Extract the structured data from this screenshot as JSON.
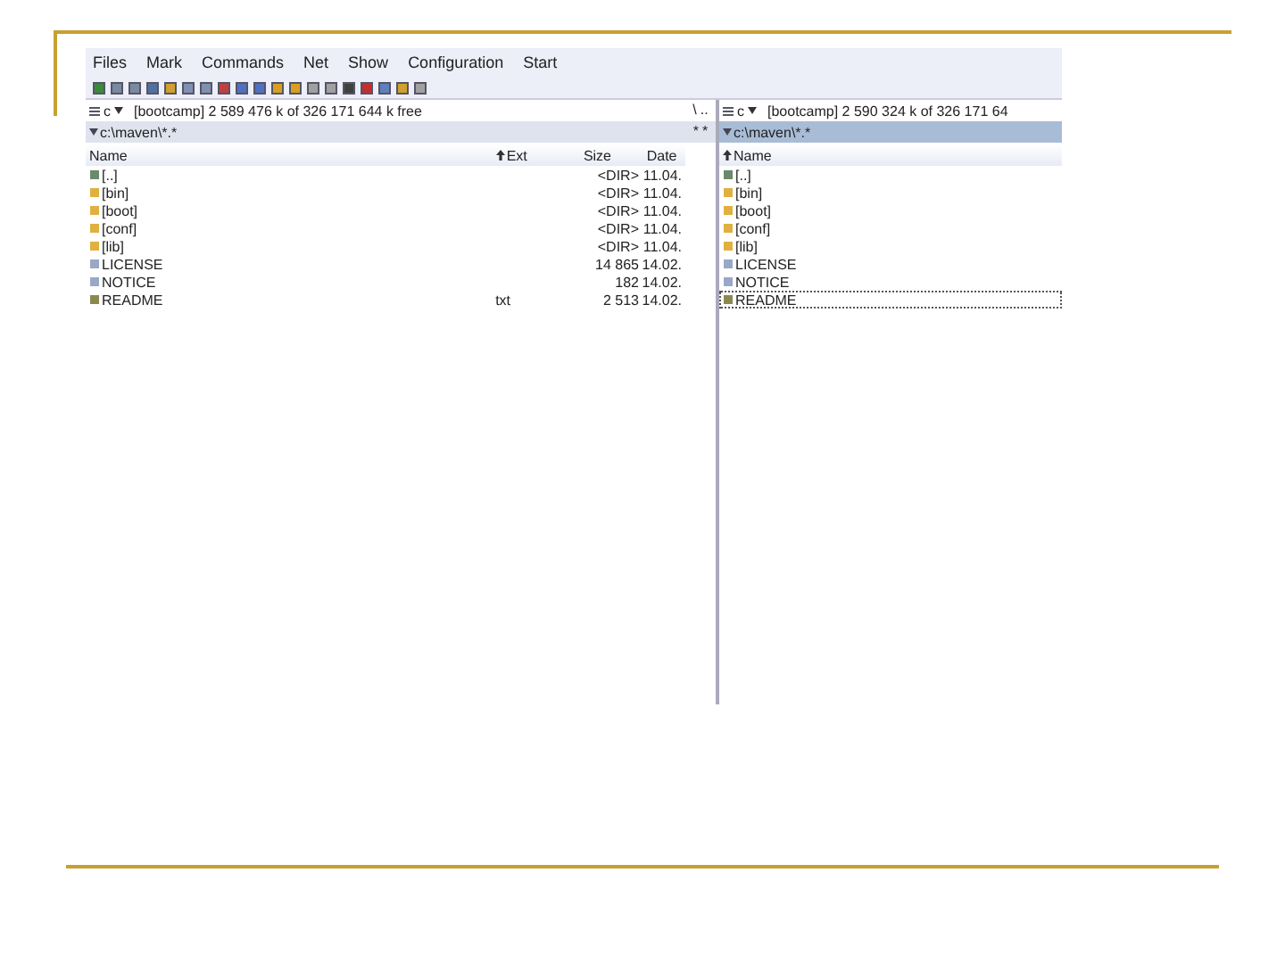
{
  "menu": [
    "Files",
    "Mark",
    "Commands",
    "Net",
    "Show",
    "Configuration",
    "Start"
  ],
  "left_panel": {
    "drive": "c",
    "drive_info": "[bootcamp]  2 589 476 k of 326 171 644 k free",
    "path": "c:\\maven\\*.*",
    "columns": [
      {
        "label": "Name",
        "sorted": false
      },
      {
        "label": "Ext",
        "sorted": true
      },
      {
        "label": "Size",
        "sorted": false
      },
      {
        "label": "Date",
        "sorted": false
      }
    ],
    "rows": [
      {
        "kind": "up",
        "name": "[..]",
        "size": "<DIR>",
        "date": "11.04."
      },
      {
        "kind": "folder",
        "name": "[bin]",
        "size": "<DIR>",
        "date": "11.04."
      },
      {
        "kind": "folder",
        "name": "[boot]",
        "size": "<DIR>",
        "date": "11.04."
      },
      {
        "kind": "folder",
        "name": "[conf]",
        "size": "<DIR>",
        "date": "11.04."
      },
      {
        "kind": "folder",
        "name": "[lib]",
        "size": "<DIR>",
        "date": "11.04."
      },
      {
        "kind": "file",
        "name": "LICENSE",
        "size": "14 865",
        "date": "14.02."
      },
      {
        "kind": "file",
        "name": "NOTICE",
        "size": "182",
        "date": "14.02."
      },
      {
        "kind": "text",
        "name": "README",
        "ext": "txt",
        "size": "2 513",
        "date": "14.02."
      }
    ]
  },
  "middle_buttons": [
    "\\",
    "..",
    "*",
    "*"
  ],
  "right_panel": {
    "drive": "c",
    "drive_info": "[bootcamp]  2 590 324 k of 326 171 64",
    "path": "c:\\maven\\*.*",
    "columns": [
      {
        "label": "Name",
        "sorted": true
      }
    ],
    "rows": [
      {
        "kind": "up",
        "name": "[..]",
        "cursor": false
      },
      {
        "kind": "folder",
        "name": "[bin]",
        "cursor": false
      },
      {
        "kind": "folder",
        "name": "[boot]",
        "cursor": false
      },
      {
        "kind": "folder",
        "name": "[conf]",
        "cursor": false
      },
      {
        "kind": "folder",
        "name": "[lib]",
        "cursor": false
      },
      {
        "kind": "file",
        "name": "LICENSE",
        "cursor": false
      },
      {
        "kind": "file",
        "name": "NOTICE",
        "cursor": false
      },
      {
        "kind": "text",
        "name": "README",
        "cursor": true
      }
    ]
  }
}
